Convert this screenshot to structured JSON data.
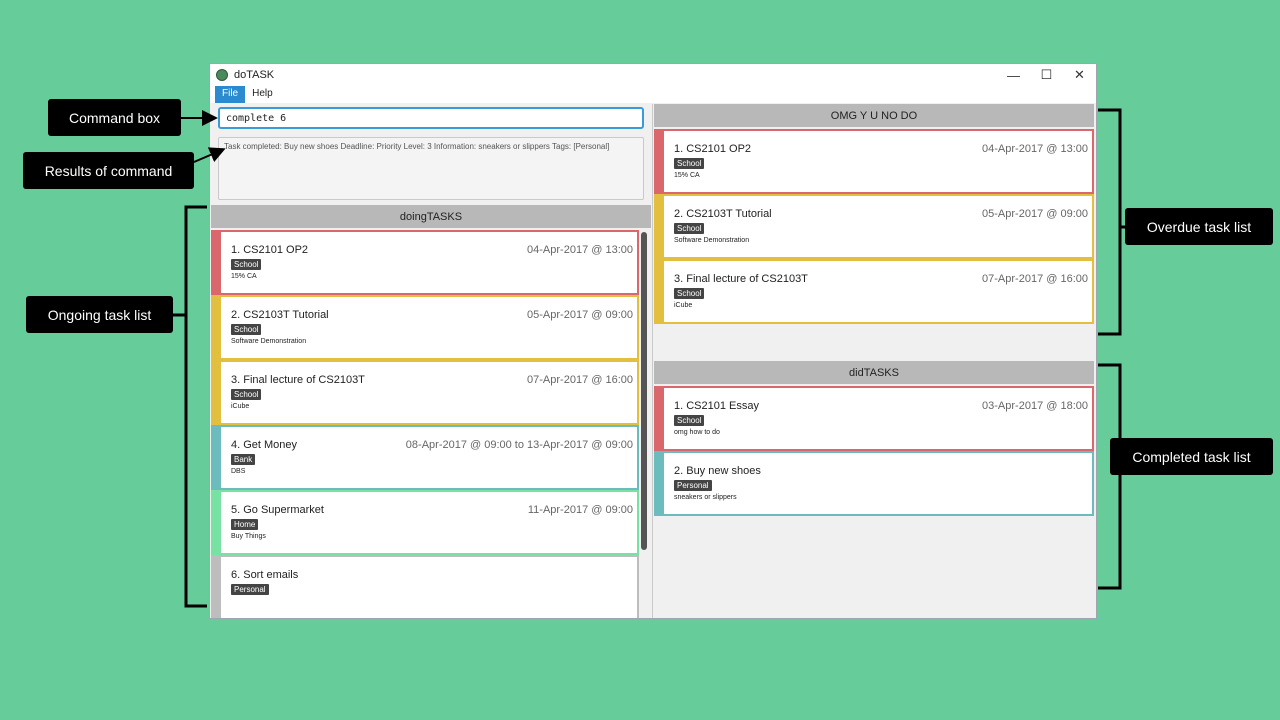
{
  "window": {
    "title": "doTASK",
    "controls": {
      "minimize": "—",
      "maximize": "☐",
      "close": "✕"
    }
  },
  "menu": {
    "file": "File",
    "help": "Help"
  },
  "command": {
    "value": "complete 6",
    "result": "Task completed: Buy new shoes Deadline:  Priority Level: 3 Information: sneakers or slippers Tags: [Personal]"
  },
  "ongoing": {
    "header": "doingTASKS",
    "tasks": [
      {
        "title": "1. CS2101 OP2",
        "date": "04-Apr-2017 @ 13:00",
        "tag": "School",
        "info": "15% CA",
        "color": "#d9676b"
      },
      {
        "title": "2. CS2103T Tutorial",
        "date": "05-Apr-2017 @ 09:00",
        "tag": "School",
        "info": "Software Demonstration",
        "color": "#e2bf3e"
      },
      {
        "title": "3. Final lecture of CS2103T",
        "date": "07-Apr-2017 @ 16:00",
        "tag": "School",
        "info": "iCube",
        "color": "#e2bf3e"
      },
      {
        "title": "4. Get Money",
        "date": "08-Apr-2017 @ 09:00 to 13-Apr-2017 @ 09:00",
        "tag": "Bank",
        "info": "DBS",
        "color": "#6cbcbe"
      },
      {
        "title": "5. Go Supermarket",
        "date": "11-Apr-2017 @ 09:00",
        "tag": "Home",
        "info": "Buy Things",
        "color": "#77e2a2"
      },
      {
        "title": "6. Sort emails",
        "date": "",
        "tag": "Personal",
        "info": "",
        "color": "#bdbdbd"
      }
    ]
  },
  "overdue": {
    "header": "OMG Y U NO DO",
    "tasks": [
      {
        "title": "1. CS2101 OP2",
        "date": "04-Apr-2017 @ 13:00",
        "tag": "School",
        "info": "15% CA",
        "color": "#d9676b"
      },
      {
        "title": "2. CS2103T Tutorial",
        "date": "05-Apr-2017 @ 09:00",
        "tag": "School",
        "info": "Software Demonstration",
        "color": "#e2bf3e"
      },
      {
        "title": "3. Final lecture of CS2103T",
        "date": "07-Apr-2017 @ 16:00",
        "tag": "School",
        "info": "iCube",
        "color": "#e2bf3e"
      }
    ]
  },
  "completed": {
    "header": "didTASKS",
    "tasks": [
      {
        "title": "1. CS2101 Essay",
        "date": "03-Apr-2017 @ 18:00",
        "tag": "School",
        "info": "omg how to do",
        "color": "#d9676b"
      },
      {
        "title": "2. Buy new shoes",
        "date": "",
        "tag": "Personal",
        "info": "sneakers or slippers",
        "color": "#6cbcbe"
      }
    ]
  },
  "annotations": {
    "command_box": "Command box",
    "results": "Results of command",
    "ongoing": "Ongoing task list",
    "overdue": "Overdue task list",
    "completed": "Completed task list"
  },
  "colors": {
    "background": "#66cc99",
    "accent": "#2a8bd0"
  }
}
